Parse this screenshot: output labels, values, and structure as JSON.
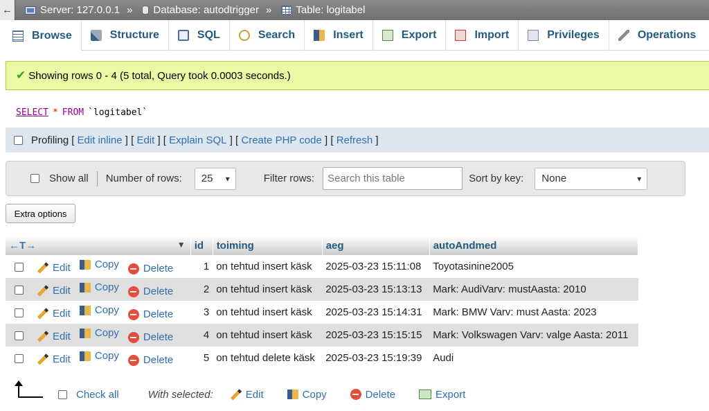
{
  "breadcrumb": {
    "back_glyph": "←",
    "server": "Server: 127.0.0.1",
    "database": "Database: autodtrigger",
    "table": "Table: logitabel",
    "separator": "»"
  },
  "tabs": [
    {
      "label": "Browse",
      "icon": "browse-icon",
      "active": true
    },
    {
      "label": "Structure",
      "icon": "structure-icon"
    },
    {
      "label": "SQL",
      "icon": "sql-icon"
    },
    {
      "label": "Search",
      "icon": "search-icon"
    },
    {
      "label": "Insert",
      "icon": "insert-icon"
    },
    {
      "label": "Export",
      "icon": "export-icon"
    },
    {
      "label": "Import",
      "icon": "import-icon"
    },
    {
      "label": "Privileges",
      "icon": "privileges-icon"
    },
    {
      "label": "Operations",
      "icon": "operations-icon"
    }
  ],
  "message": {
    "text": "Showing rows 0 - 4 (5 total, Query took 0.0003 seconds.)",
    "color": "#ebf8a4"
  },
  "query": {
    "select": "SELECT",
    "star": "*",
    "from": "FROM",
    "table": "`logitabel`"
  },
  "profiling": {
    "label": "Profiling",
    "links": [
      "Edit inline",
      "Edit",
      "Explain SQL",
      "Create PHP code",
      "Refresh"
    ]
  },
  "nav": {
    "show_all": "Show all",
    "number_of_rows_label": "Number of rows:",
    "number_of_rows_value": "25",
    "filter_label": "Filter rows:",
    "filter_placeholder": "Search this table",
    "sort_label": "Sort by key:",
    "sort_value": "None"
  },
  "extra_options": "Extra options",
  "table": {
    "arrows": "←T→",
    "columns": [
      "id",
      "toiming",
      "aeg",
      "autoAndmed"
    ],
    "actions": {
      "edit": "Edit",
      "copy": "Copy",
      "delete": "Delete"
    },
    "rows": [
      {
        "id": "1",
        "toiming": "on tehtud insert käsk",
        "aeg": "2025-03-23 15:11:08",
        "autoAndmed": "Toyotasinine2005"
      },
      {
        "id": "2",
        "toiming": "on tehtud insert käsk",
        "aeg": "2025-03-23 15:13:13",
        "autoAndmed": "Mark: AudiVarv: mustAasta: 2010"
      },
      {
        "id": "3",
        "toiming": "on tehtud insert käsk",
        "aeg": "2025-03-23 15:14:31",
        "autoAndmed": "Mark: BMW Varv: must Aasta: 2023"
      },
      {
        "id": "4",
        "toiming": "on tehtud insert käsk",
        "aeg": "2025-03-23 15:15:15",
        "autoAndmed": "Mark: Volkswagen Varv: valge Aasta: 2011"
      },
      {
        "id": "5",
        "toiming": "on tehtud delete käsk",
        "aeg": "2025-03-23 15:19:39",
        "autoAndmed": "Audi"
      }
    ]
  },
  "bottom": {
    "check_all": "Check all",
    "with_selected": "With selected:",
    "edit": "Edit",
    "copy": "Copy",
    "delete": "Delete",
    "export": "Export"
  },
  "colors": {
    "link": "#2f6fae",
    "header_text": "#235a81",
    "alt_row": "#dfdfdf"
  }
}
